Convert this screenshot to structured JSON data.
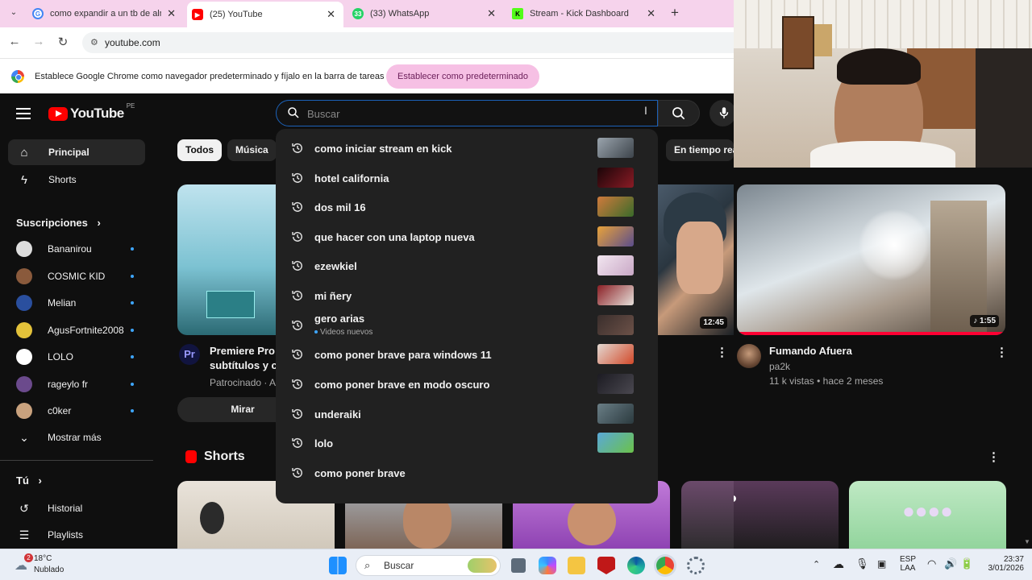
{
  "browser": {
    "tabs": [
      {
        "title": "como expandir a un tb de alma",
        "favicon": "google-icon",
        "active": false
      },
      {
        "title": "(25) YouTube",
        "favicon": "youtube-icon",
        "active": true
      },
      {
        "title": "(33) WhatsApp",
        "favicon": "whatsapp-icon",
        "badge": "33",
        "active": false
      },
      {
        "title": "Stream - Kick Dashboard",
        "favicon": "kick-icon",
        "active": false
      }
    ],
    "new_tab": "+",
    "url": "youtube.com",
    "infobar": {
      "message": "Establece Google Chrome como navegador predeterminado y fíjalo en la barra de tareas",
      "button": "Establecer como predeterminado"
    }
  },
  "youtube": {
    "logo_text": "YouTube",
    "region": "PE",
    "search_placeholder": "Buscar",
    "sidebar": {
      "main": [
        {
          "label": "Principal",
          "icon": "home-icon",
          "active": true
        },
        {
          "label": "Shorts",
          "icon": "shorts-icon",
          "active": false
        }
      ],
      "subs_title": "Suscripciones",
      "subs": [
        {
          "name": "Bananirou",
          "color": "#dddddd"
        },
        {
          "name": "COSMIC KID",
          "color": "#8a5a3c"
        },
        {
          "name": "Melian",
          "color": "#2a4f9e"
        },
        {
          "name": "AgusFortnite2008",
          "color": "#e3c23a"
        },
        {
          "name": "LOLO",
          "color": "#ffffff"
        },
        {
          "name": "rageylo fr",
          "color": "#6b4a8c"
        },
        {
          "name": "c0ker",
          "color": "#c9a27e"
        }
      ],
      "show_more": "Mostrar más",
      "you_title": "Tú",
      "you": [
        {
          "label": "Historial",
          "icon": "history-icon"
        },
        {
          "label": "Playlists",
          "icon": "playlist-icon"
        }
      ]
    },
    "chips": [
      "Todos",
      "Música",
      "En tiempo real"
    ],
    "suggestions": [
      {
        "text": "como iniciar stream en kick",
        "thumb": "#9aa4ad"
      },
      {
        "text": "hotel california",
        "thumb": "#3b0d12"
      },
      {
        "text": "dos mil 16",
        "thumb": "#b46a3c"
      },
      {
        "text": "que hacer con una laptop nueva",
        "thumb": "#d08a3a"
      },
      {
        "text": "ezewkiel",
        "thumb": "#d7c8d6"
      },
      {
        "text": "mi ñery",
        "thumb": "#8b1f25"
      },
      {
        "text": "gero arias",
        "sub": "Videos nuevos",
        "thumb": "#3a2e2c"
      },
      {
        "text": "como poner brave para windows 11",
        "thumb": "#e3d9d2"
      },
      {
        "text": "como poner brave en modo oscuro",
        "thumb": "#1c1b22"
      },
      {
        "text": "underaiki",
        "thumb": "#6a7e86"
      },
      {
        "text": "lolo",
        "thumb": "#5aa8d8"
      },
      {
        "text": "como poner brave",
        "thumb": "#212121"
      }
    ],
    "ad": {
      "title": "Premiere Pro c… subtítulos y c…",
      "line1": "Premiere Pro c",
      "line2": "subtítulos y c",
      "sponsor": "Patrocinado · A",
      "button": "Mirar",
      "avatar_text": "Pr"
    },
    "video_mid": {
      "duration": "12:45"
    },
    "video_right": {
      "title": "Fumando Afuera",
      "channel": "pa2k",
      "meta": "11 k vistas • hace 2 meses",
      "duration": "1:55"
    },
    "shorts_title": "Shorts"
  },
  "taskbar": {
    "weather_temp": "18°C",
    "weather_desc": "Nublado",
    "weather_badge": "2",
    "search": "Buscar",
    "lang1": "ESP",
    "lang2": "LAA",
    "time": "23:37",
    "date": "3/01/2026"
  }
}
